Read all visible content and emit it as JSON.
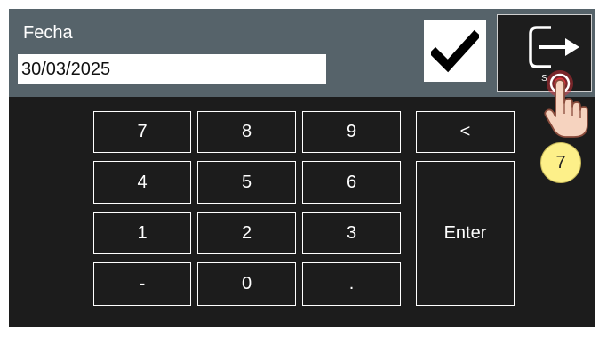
{
  "header": {
    "date_label": "Fecha",
    "date_value": "30/03/2025",
    "confirm_icon": "checkmark-icon",
    "exit_icon": "exit-arrow-icon",
    "exit_label": "S",
    "background_color": "#56636a"
  },
  "keypad": {
    "keys": [
      "7",
      "8",
      "9",
      "4",
      "5",
      "6",
      "1",
      "2",
      "3",
      "-",
      "0",
      "."
    ],
    "backspace_label": "<",
    "enter_label": "Enter"
  },
  "overlay": {
    "pointer_icon": "hand-pointer-icon",
    "step_number": "7",
    "highlight_color": "#e8323c"
  }
}
